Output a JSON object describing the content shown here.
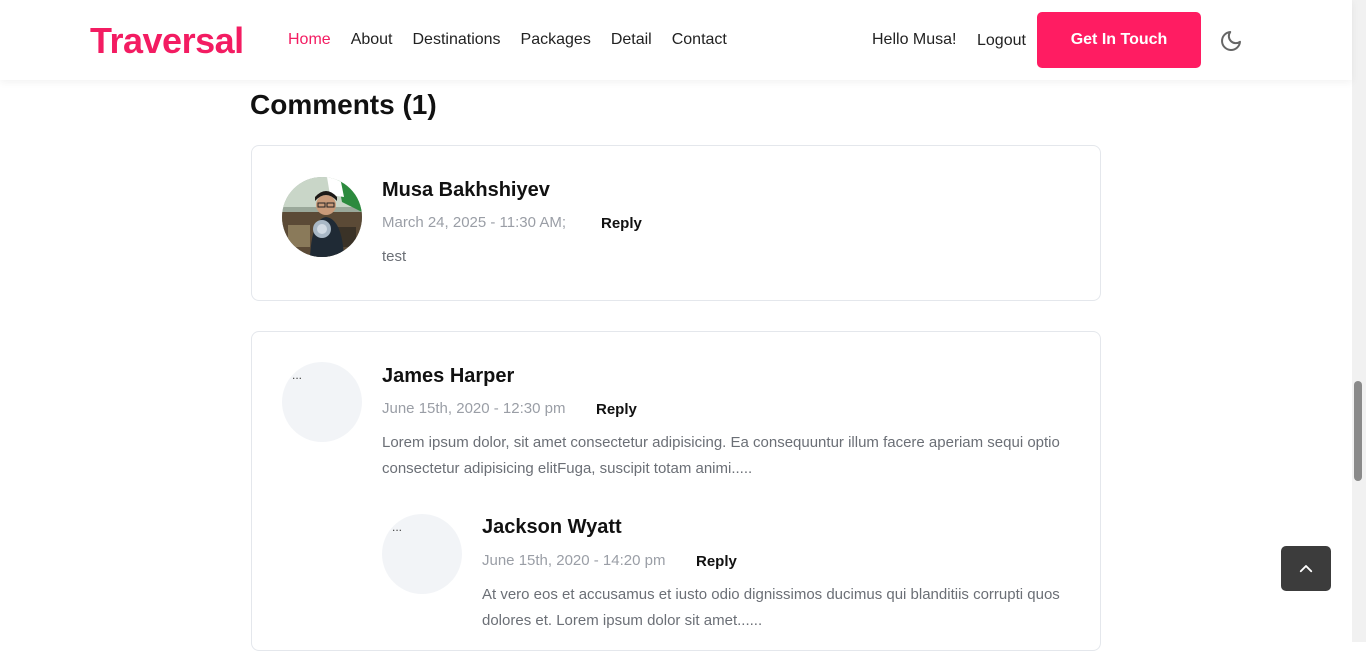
{
  "brand": "Traversal",
  "nav": {
    "links": [
      "Home",
      "About",
      "Destinations",
      "Packages",
      "Detail",
      "Contact"
    ],
    "greeting": "Hello Musa!",
    "logout": "Logout",
    "cta": "Get In Touch"
  },
  "comments": {
    "heading": "Comments (1)",
    "items": [
      {
        "author": "Musa Bakhshiyev",
        "date": "March 24, 2025 - 11:30 AM;",
        "reply": "Reply",
        "text": "test"
      },
      {
        "author": "James Harper",
        "date": "June 15th, 2020 - 12:30 pm",
        "reply": "Reply",
        "text": "Lorem ipsum dolor, sit amet consectetur adipisicing. Ea consequuntur illum facere aperiam sequi optio consectetur adipisicing elitFuga, suscipit totam animi.....",
        "avatar_alt": "..."
      },
      {
        "author": "Jackson Wyatt",
        "date": "June 15th, 2020 - 14:20 pm",
        "reply": "Reply",
        "text": "At vero eos et accusamus et iusto odio dignissimos ducimus qui blanditiis corrupti quos dolores et. Lorem ipsum dolor sit amet......",
        "avatar_alt": "..."
      }
    ]
  },
  "colors": {
    "brand": "#f31c62",
    "cta_bg": "#ff1c62",
    "to_top_bg": "#3c3c3c"
  },
  "icons": {
    "theme_toggle": "moon-icon",
    "back_to_top": "chevron-up-icon"
  }
}
